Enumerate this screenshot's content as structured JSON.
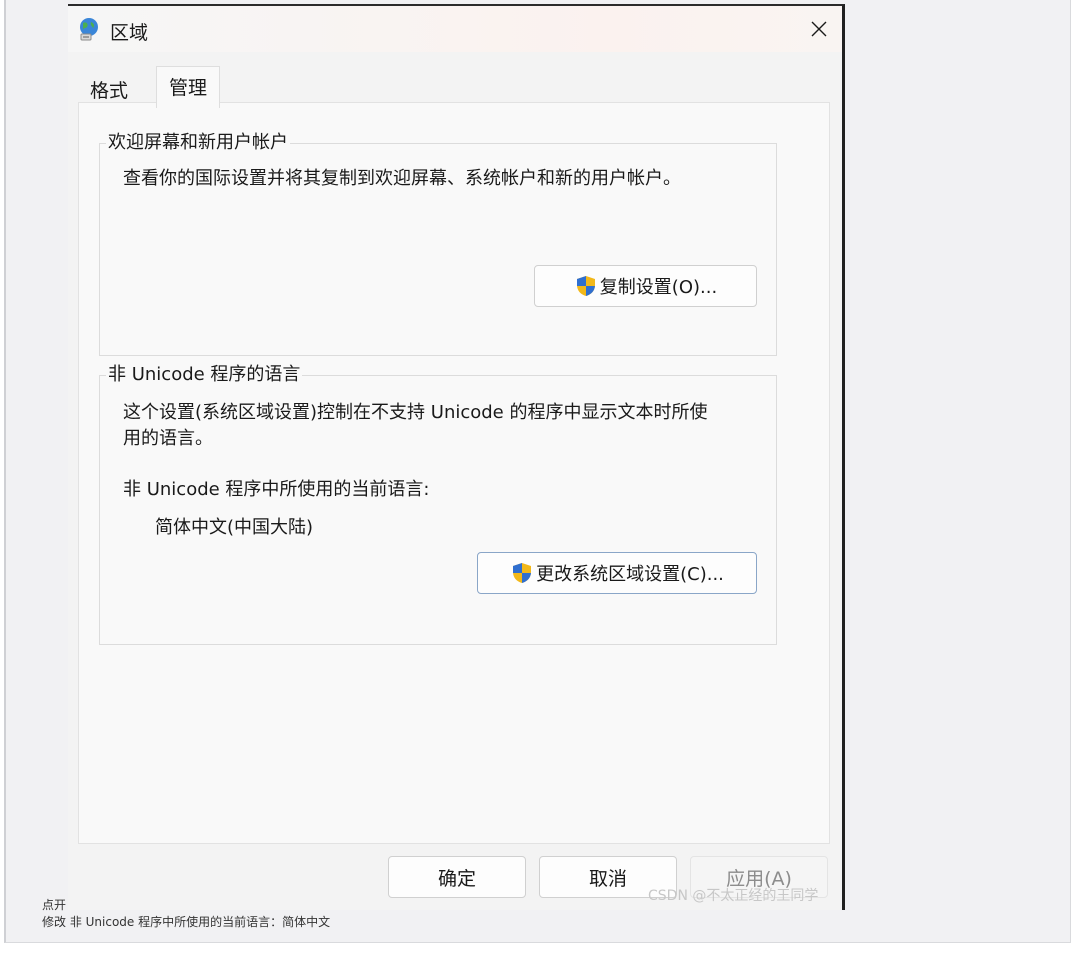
{
  "dialog": {
    "title": "区域",
    "tabs": [
      {
        "label": "格式",
        "active": false
      },
      {
        "label": "管理",
        "active": true
      }
    ]
  },
  "welcome_group": {
    "title": "欢迎屏幕和新用户帐户",
    "description": "查看你的国际设置并将其复制到欢迎屏幕、系统帐户和新的用户帐户。",
    "copy_button": "复制设置(O)..."
  },
  "unicode_group": {
    "title": "非 Unicode 程序的语言",
    "description_line1": "这个设置(系统区域设置)控制在不支持 Unicode 的程序中显示文本时所使",
    "description_line2": "用的语言。",
    "current_label": "非 Unicode 程序中所使用的当前语言:",
    "current_value": "简体中文(中国大陆)",
    "change_button": "更改系统区域设置(C)..."
  },
  "footer": {
    "ok": "确定",
    "cancel": "取消",
    "apply": "应用(A)"
  },
  "watermark": "CSDN @不太正经的王同学",
  "captions": {
    "line1": "点开",
    "line2": "修改 非 Unicode 程序中所使用的当前语言：简体中文"
  },
  "colors": {
    "shield_blue": "#2f6fd0",
    "shield_yellow": "#f2b81a"
  }
}
